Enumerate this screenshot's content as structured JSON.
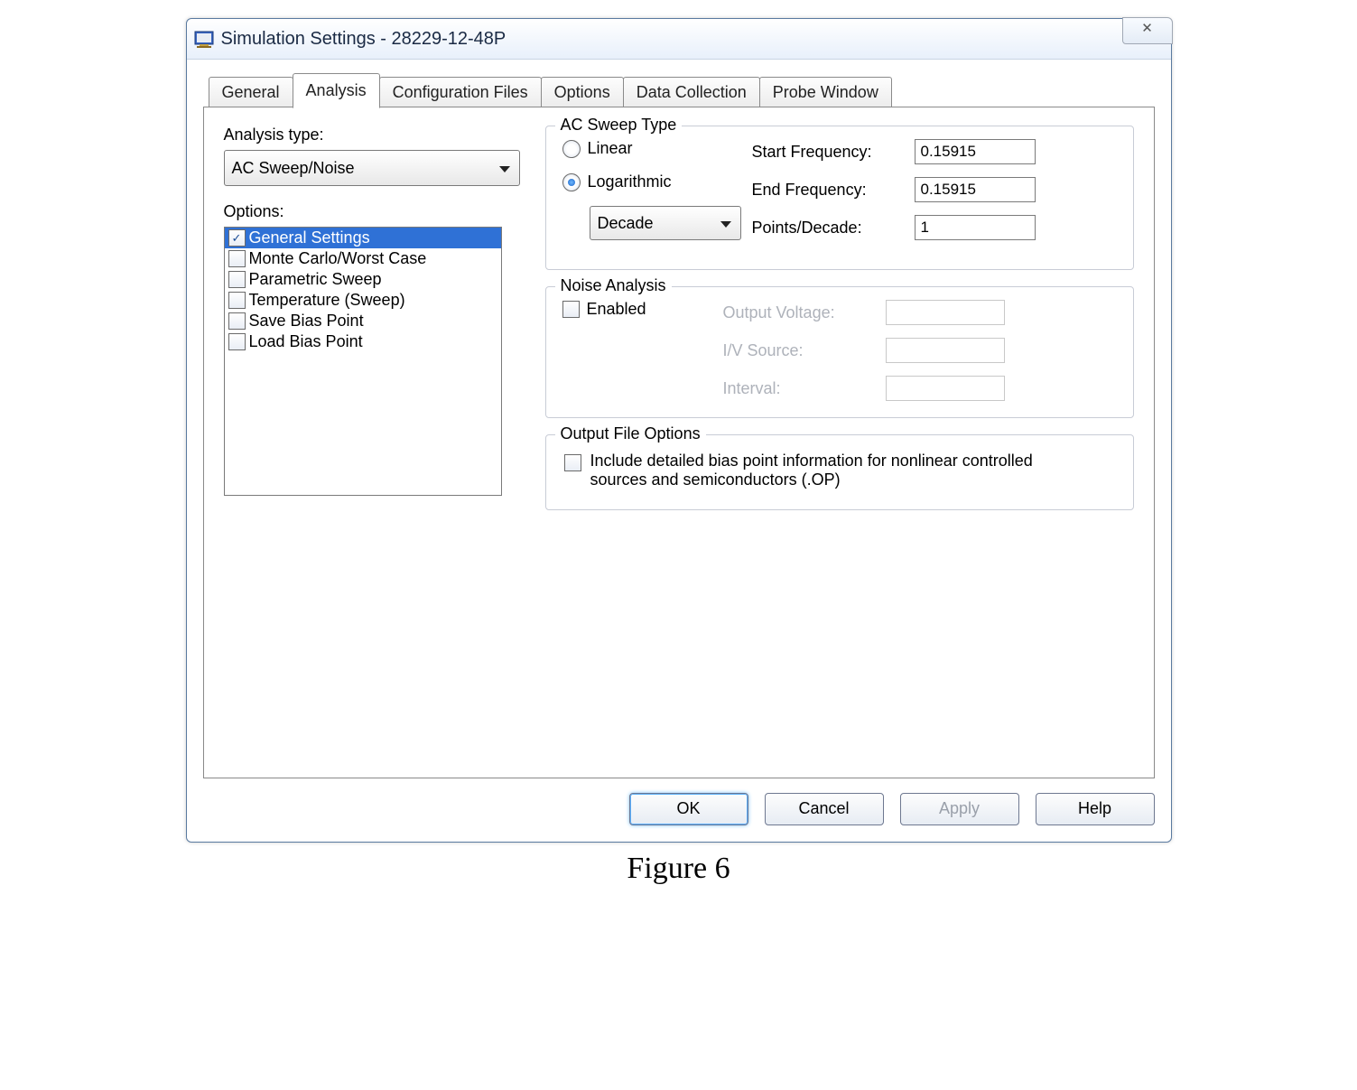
{
  "window": {
    "title": "Simulation Settings - 28229-12-48P",
    "close_glyph": "✕"
  },
  "tabs": [
    {
      "label": "General",
      "active": false
    },
    {
      "label": "Analysis",
      "active": true
    },
    {
      "label": "Configuration Files",
      "active": false
    },
    {
      "label": "Options",
      "active": false
    },
    {
      "label": "Data Collection",
      "active": false
    },
    {
      "label": "Probe Window",
      "active": false
    }
  ],
  "analysis": {
    "type_label": "Analysis type:",
    "type_value": "AC Sweep/Noise",
    "options_label": "Options:",
    "options": [
      {
        "label": "General Settings",
        "checked": true,
        "selected": true
      },
      {
        "label": "Monte Carlo/Worst Case",
        "checked": false,
        "selected": false
      },
      {
        "label": "Parametric Sweep",
        "checked": false,
        "selected": false
      },
      {
        "label": "Temperature (Sweep)",
        "checked": false,
        "selected": false
      },
      {
        "label": "Save Bias Point",
        "checked": false,
        "selected": false
      },
      {
        "label": "Load Bias Point",
        "checked": false,
        "selected": false
      }
    ]
  },
  "ac_sweep": {
    "legend": "AC Sweep Type",
    "linear_label": "Linear",
    "log_label": "Logarithmic",
    "selected": "log",
    "scale_value": "Decade",
    "start_label": "Start Frequency:",
    "start_value": "0.15915",
    "end_label": "End Frequency:",
    "end_value": "0.15915",
    "pts_label": "Points/Decade:",
    "pts_value": "1"
  },
  "noise": {
    "legend": "Noise Analysis",
    "enabled_label": "Enabled",
    "enabled": false,
    "out_label": "Output Voltage:",
    "iv_label": "I/V Source:",
    "interval_label": "Interval:"
  },
  "outfile": {
    "legend": "Output File Options",
    "include_label": "Include detailed bias point information for nonlinear controlled sources and semiconductors (.OP)",
    "include_checked": false
  },
  "buttons": {
    "ok": "OK",
    "cancel": "Cancel",
    "apply": "Apply",
    "help": "Help"
  },
  "caption": "Figure 6"
}
